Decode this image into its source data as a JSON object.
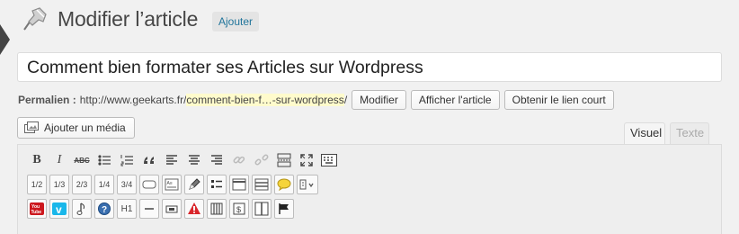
{
  "header": {
    "title": "Modifier l’article",
    "add_new_label": "Ajouter"
  },
  "post": {
    "title_value": "Comment bien formater ses Articles sur Wordpress"
  },
  "permalink": {
    "label": "Permalien :",
    "base_url": "http://www.geekarts.fr/",
    "slug": "comment-bien-f…-sur-wordpress",
    "trailing": "/",
    "buttons": {
      "edit": "Modifier",
      "view": "Afficher l'article",
      "shortlink": "Obtenir le lien court"
    }
  },
  "media": {
    "add_media_label": "Ajouter un média"
  },
  "editor_tabs": {
    "visual": "Visuel",
    "text": "Texte"
  },
  "toolbar": {
    "row1": [
      {
        "name": "bold-button",
        "glyph": "B"
      },
      {
        "name": "italic-button",
        "glyph": "I"
      },
      {
        "name": "strikethrough-button",
        "glyph": "ABC"
      }
    ],
    "row2_fractions": [
      "1/2",
      "1/3",
      "2/3",
      "1/4",
      "3/4"
    ],
    "row3": {
      "h1": "H1"
    }
  },
  "colors": {
    "accent": "#21759b",
    "slug_highlight": "#fffbcc",
    "youtube": "#cc181e",
    "vimeo": "#1ab7ea",
    "alert": "#d9262b"
  }
}
